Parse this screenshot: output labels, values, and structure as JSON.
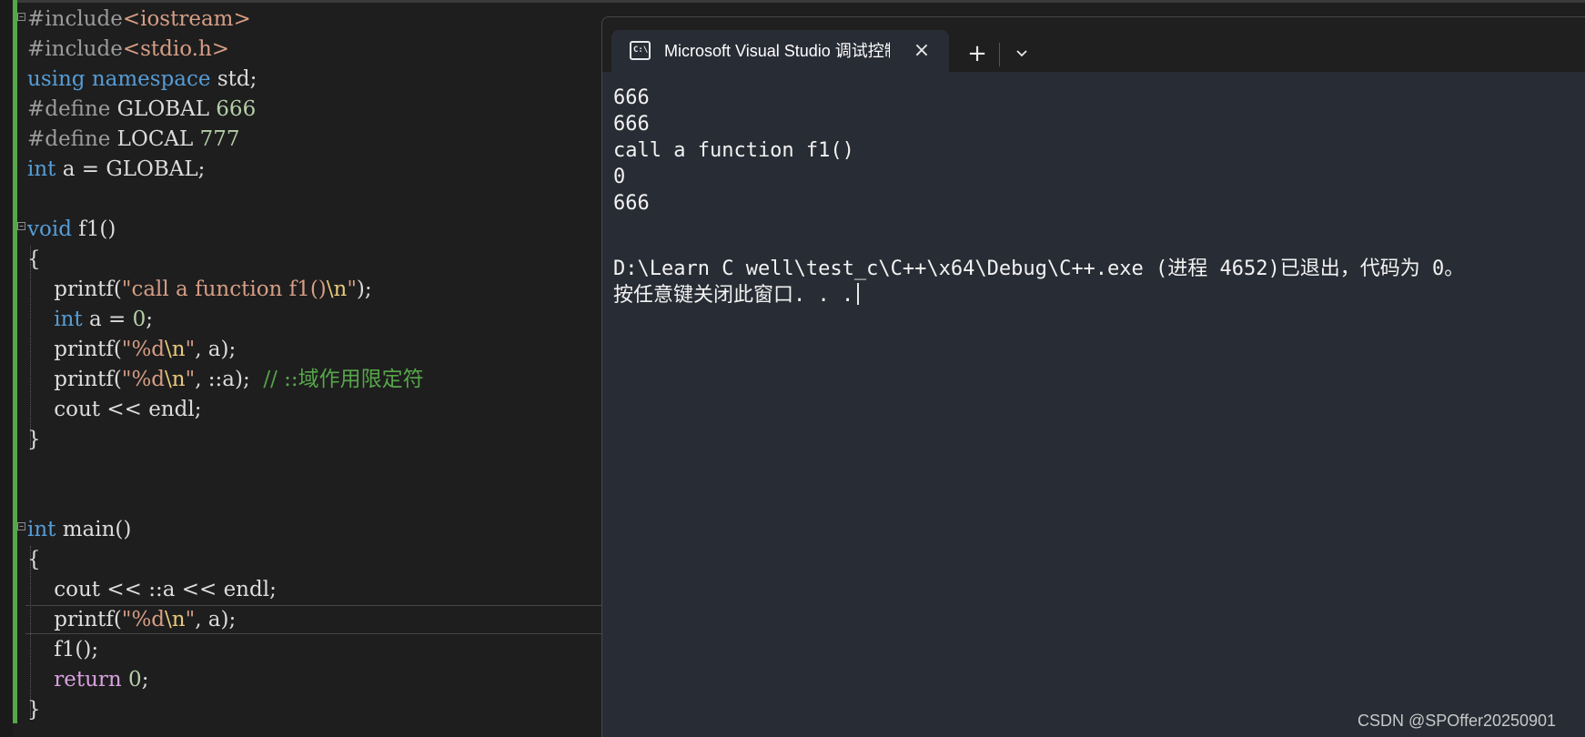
{
  "colors": {
    "editor_bg": "#1e1e1e",
    "keyword": "#569cd6",
    "preprocessor": "#9b9b9b",
    "include_path": "#d69d85",
    "number": "#b5cea8",
    "string": "#d69d85",
    "escape": "#e8c97a",
    "comment": "#57a64a",
    "control_keyword": "#d8a0df",
    "plain": "#dcdcdc",
    "terminal_bg": "#282c34",
    "terminal_text": "#f2f2f2"
  },
  "editor": {
    "lines": [
      [
        {
          "t": "#include",
          "c": "preprocessor"
        },
        {
          "t": "<iostream>",
          "c": "include_path"
        }
      ],
      [
        {
          "t": "#include",
          "c": "preprocessor"
        },
        {
          "t": "<stdio.h>",
          "c": "include_path"
        }
      ],
      [
        {
          "t": "using",
          "c": "keyword"
        },
        {
          "t": " ",
          "c": "plain"
        },
        {
          "t": "namespace",
          "c": "keyword"
        },
        {
          "t": " std;",
          "c": "plain"
        }
      ],
      [
        {
          "t": "#define",
          "c": "preprocessor"
        },
        {
          "t": " GLOBAL ",
          "c": "plain"
        },
        {
          "t": "666",
          "c": "number"
        }
      ],
      [
        {
          "t": "#define",
          "c": "preprocessor"
        },
        {
          "t": " LOCAL ",
          "c": "plain"
        },
        {
          "t": "777",
          "c": "number"
        }
      ],
      [
        {
          "t": "int",
          "c": "keyword"
        },
        {
          "t": " a = GLOBAL;",
          "c": "plain"
        }
      ],
      [],
      [
        {
          "t": "void",
          "c": "keyword"
        },
        {
          "t": " f1()",
          "c": "plain"
        }
      ],
      [
        {
          "t": "{",
          "c": "plain"
        }
      ],
      [
        {
          "t": "    printf(",
          "c": "plain"
        },
        {
          "t": "\"call a function f1()",
          "c": "string"
        },
        {
          "t": "\\n",
          "c": "escape"
        },
        {
          "t": "\"",
          "c": "string"
        },
        {
          "t": ");",
          "c": "plain"
        }
      ],
      [
        {
          "t": "    ",
          "c": "plain"
        },
        {
          "t": "int",
          "c": "keyword"
        },
        {
          "t": " a = ",
          "c": "plain"
        },
        {
          "t": "0",
          "c": "number"
        },
        {
          "t": ";",
          "c": "plain"
        }
      ],
      [
        {
          "t": "    printf(",
          "c": "plain"
        },
        {
          "t": "\"%d",
          "c": "string"
        },
        {
          "t": "\\n",
          "c": "escape"
        },
        {
          "t": "\"",
          "c": "string"
        },
        {
          "t": ", a);",
          "c": "plain"
        }
      ],
      [
        {
          "t": "    printf(",
          "c": "plain"
        },
        {
          "t": "\"%d",
          "c": "string"
        },
        {
          "t": "\\n",
          "c": "escape"
        },
        {
          "t": "\"",
          "c": "string"
        },
        {
          "t": ", ::a);  ",
          "c": "plain"
        },
        {
          "t": "// ::域作用限定符",
          "c": "comment"
        }
      ],
      [
        {
          "t": "    cout << endl;",
          "c": "plain"
        }
      ],
      [
        {
          "t": "}",
          "c": "plain"
        }
      ],
      [],
      [],
      [
        {
          "t": "int",
          "c": "keyword"
        },
        {
          "t": " main()",
          "c": "plain"
        }
      ],
      [
        {
          "t": "{",
          "c": "plain"
        }
      ],
      [
        {
          "t": "    cout << ::a << endl;",
          "c": "plain"
        }
      ],
      [
        {
          "t": "    printf(",
          "c": "plain"
        },
        {
          "t": "\"%d",
          "c": "string"
        },
        {
          "t": "\\n",
          "c": "escape"
        },
        {
          "t": "\"",
          "c": "string"
        },
        {
          "t": ", a);",
          "c": "plain"
        }
      ],
      [
        {
          "t": "    f1();",
          "c": "plain"
        }
      ],
      [
        {
          "t": "    ",
          "c": "plain"
        },
        {
          "t": "return",
          "c": "control_keyword"
        },
        {
          "t": " ",
          "c": "plain"
        },
        {
          "t": "0",
          "c": "number"
        },
        {
          "t": ";",
          "c": "plain"
        }
      ],
      [
        {
          "t": "}",
          "c": "plain"
        }
      ]
    ]
  },
  "terminal": {
    "tab_icon_text": "C:\\",
    "tab_title": "Microsoft Visual Studio 调试控制台",
    "close_icon": "×",
    "new_tab_icon": "+",
    "output_lines": [
      "666",
      "666",
      "call a function f1()",
      "0",
      "666",
      "",
      "D:\\Learn C well\\test_c\\C++\\x64\\Debug\\C++.exe (进程 4652)已退出，代码为 0。",
      "按任意键关闭此窗口. . ."
    ]
  },
  "watermark": "CSDN @SPOffer20250901"
}
